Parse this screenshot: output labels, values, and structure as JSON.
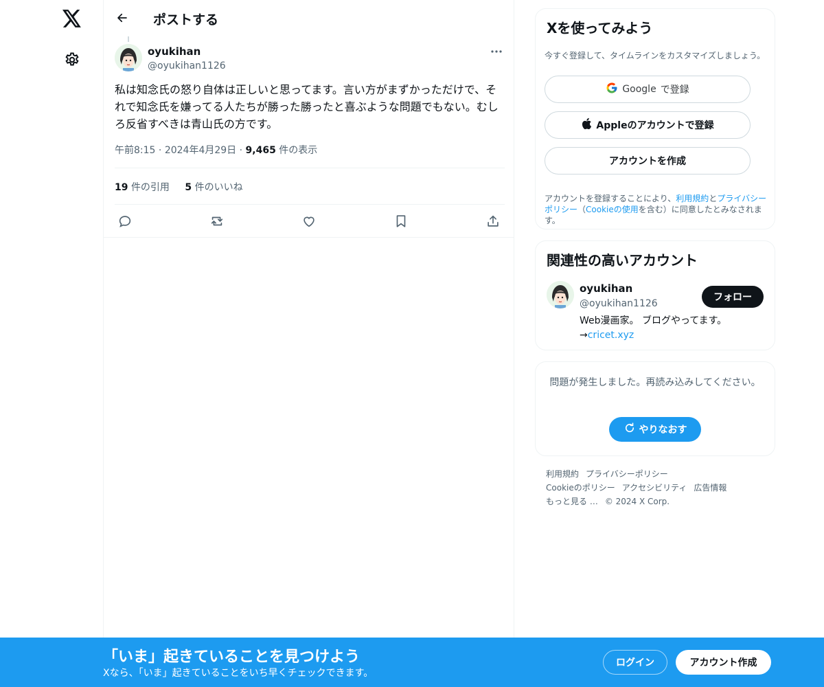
{
  "nav": {
    "logo_icon": "x-logo-icon",
    "settings_icon": "gear-icon"
  },
  "header": {
    "back_icon": "arrow-left-icon",
    "title": "ポストする"
  },
  "post": {
    "author_name": "oyukihan",
    "author_handle": "@oyukihan1126",
    "text": "私は知念氏の怒り自体は正しいと思ってます。言い方がまずかっただけで、それで知念氏を嫌ってる人たちが勝った勝ったと喜ぶような問題でもない。むしろ反省すべきは青山氏の方です。",
    "time": "午前8:15",
    "date": "2024年4月29日",
    "views_count": "9,465",
    "views_label": "件の表示",
    "quotes_count": "19",
    "quotes_label": "件の引用",
    "likes_count": "5",
    "likes_label": "件のいいね",
    "actions": [
      "reply-icon",
      "repost-icon",
      "like-icon",
      "bookmark-icon",
      "share-icon"
    ]
  },
  "signup_card": {
    "title": "Xを使ってみよう",
    "subtitle": "今すぐ登録して、タイムラインをカスタマイズしましょう。",
    "google_label": "Google",
    "google_suffix": "で登録",
    "apple_label": "Appleのアカウントで登録",
    "create_label": "アカウントを作成",
    "terms_prefix": "アカウントを登録することにより、",
    "terms_link": "利用規約",
    "terms_and": "と",
    "privacy_link": "プライバシーポリシー",
    "terms_paren_open": "（",
    "cookie_link": "Cookieの使用",
    "terms_suffix": "を含む）に同意したとみなされます。"
  },
  "related": {
    "title": "関連性の高いアカウント",
    "name": "oyukihan",
    "handle": "@oyukihan1126",
    "bio_line1": "Web漫画家。 ブログやってます。",
    "bio_arrow": "→",
    "bio_link": "cricet.xyz",
    "follow_label": "フォロー"
  },
  "error_card": {
    "message": "問題が発生しました。再読み込みしてください。",
    "retry_label": "やりなおす"
  },
  "footer": {
    "links": [
      "利用規約",
      "プライバシーポリシー",
      "Cookieのポリシー",
      "アクセシビリティ",
      "広告情報",
      "もっと見る …",
      "© 2024 X Corp."
    ]
  },
  "bottom_bar": {
    "title": "「いま」起きていることを見つけよう",
    "subtitle": "Xなら、「いま」起きていることをいち早くチェックできます。",
    "login_label": "ログイン",
    "signup_label": "アカウント作成"
  },
  "colors": {
    "accent": "#1d9bf0",
    "text": "#0f1419",
    "muted": "#536471",
    "border": "#eff3f4"
  }
}
